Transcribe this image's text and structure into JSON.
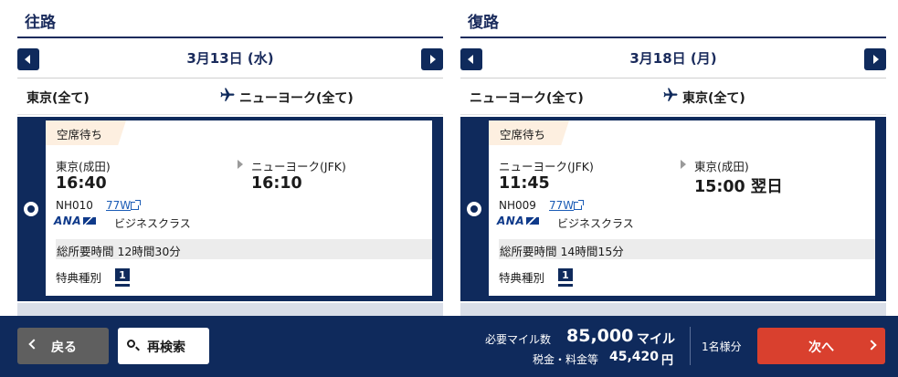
{
  "outbound": {
    "title": "往路",
    "date": "3月13日 (水)",
    "route_from": "東京(全て)",
    "route_to": "ニューヨーク(全て)",
    "flight": {
      "status": "空席待ち",
      "dep_city": "東京(成田)",
      "dep_time": "16:40",
      "arr_city": "ニューヨーク(JFK)",
      "arr_time": "16:10",
      "flight_no": "NH010",
      "aircraft": "77W",
      "airline": "ANA",
      "cabin": "ビジネスクラス",
      "duration": "総所要時間 12時間30分",
      "award_label": "特典種別",
      "award_type": "1"
    }
  },
  "inbound": {
    "title": "復路",
    "date": "3月18日 (月)",
    "route_from": "ニューヨーク(全て)",
    "route_to": "東京(全て)",
    "flight": {
      "status": "空席待ち",
      "dep_city": "ニューヨーク(JFK)",
      "dep_time": "11:45",
      "arr_city": "東京(成田)",
      "arr_time": "15:00 翌日",
      "flight_no": "NH009",
      "aircraft": "77W",
      "airline": "ANA",
      "cabin": "ビジネスクラス",
      "duration": "総所要時間 14時間15分",
      "award_label": "特典種別",
      "award_type": "1"
    }
  },
  "footer": {
    "back_label": "戻る",
    "search_label": "再検索",
    "miles_label": "必要マイル数",
    "miles_value": "85,000",
    "miles_unit": "マイル",
    "tax_label": "税金・料金等",
    "tax_value": "45,420",
    "tax_unit": "円",
    "pax": "1名様分",
    "next_label": "次へ"
  },
  "colors": {
    "navy": "#0f2a5c",
    "accent_red": "#d9402e",
    "badge_bg": "#fdefe0"
  }
}
